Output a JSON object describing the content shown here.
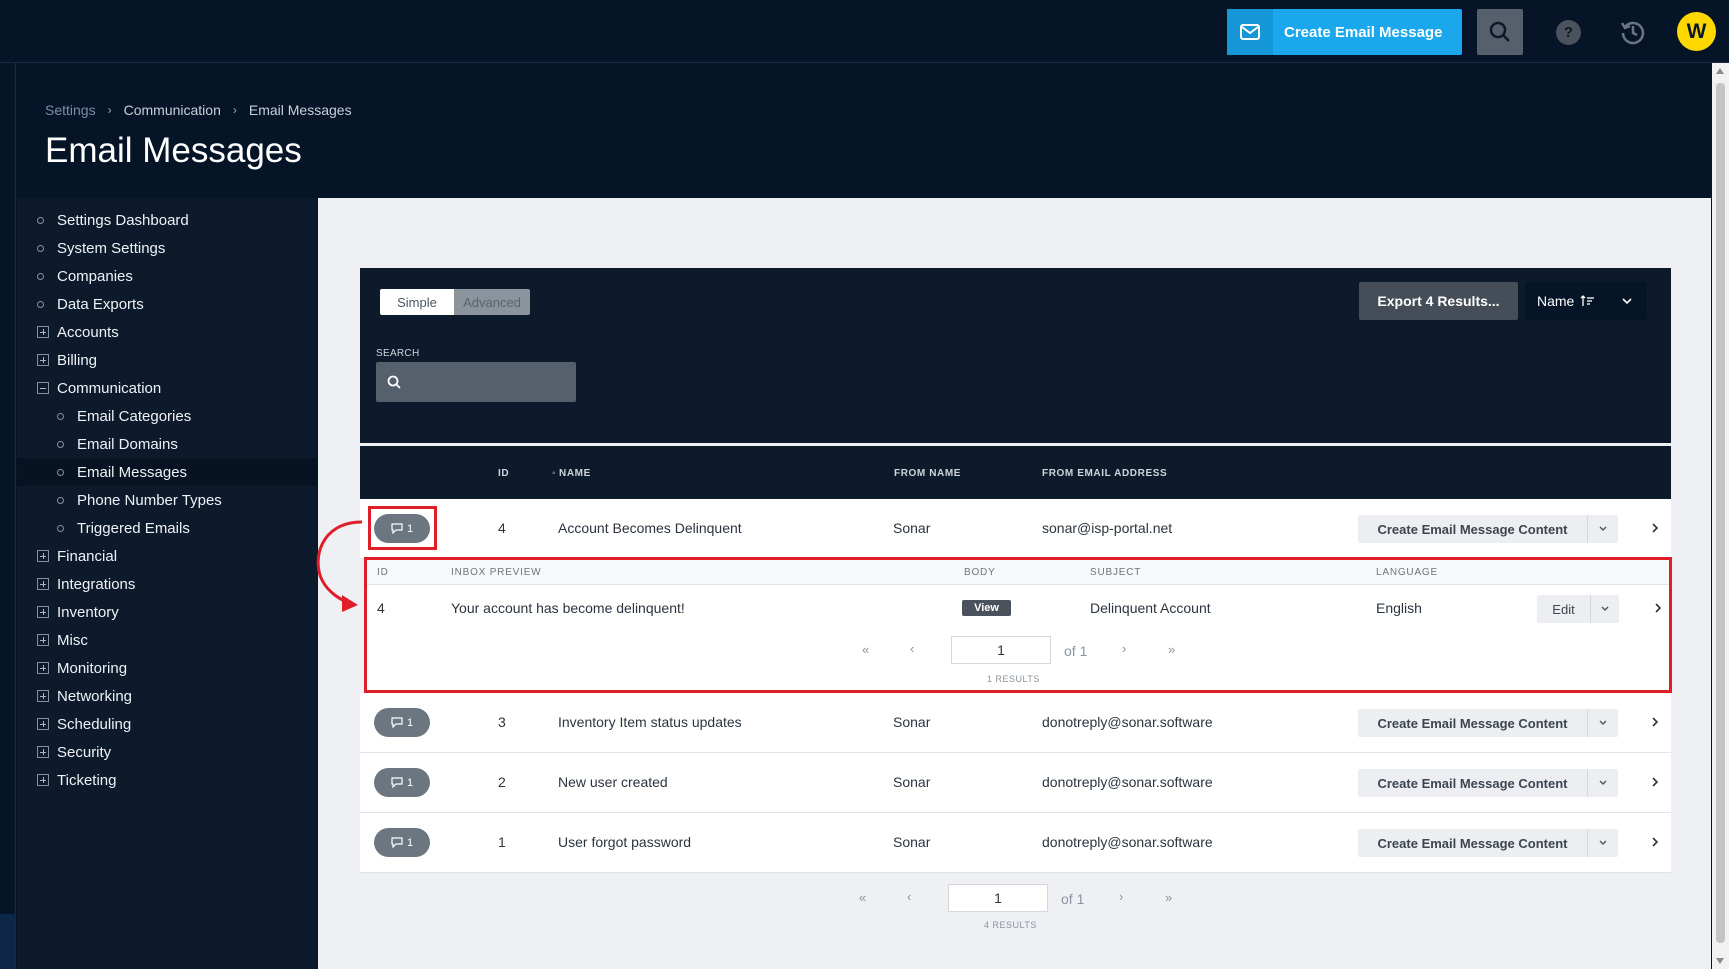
{
  "topbar": {
    "create_label": "Create Email Message",
    "avatar_initial": "W",
    "help_glyph": "?"
  },
  "breadcrumb": {
    "items": [
      "Settings",
      "Communication",
      "Email Messages"
    ]
  },
  "page": {
    "title": "Email Messages"
  },
  "sidebar": {
    "items": [
      {
        "label": "Settings Dashboard",
        "type": "leaf"
      },
      {
        "label": "System Settings",
        "type": "leaf"
      },
      {
        "label": "Companies",
        "type": "leaf"
      },
      {
        "label": "Data Exports",
        "type": "leaf"
      },
      {
        "label": "Accounts",
        "type": "collapsed"
      },
      {
        "label": "Billing",
        "type": "collapsed"
      },
      {
        "label": "Communication",
        "type": "expanded"
      },
      {
        "label": "Email Categories",
        "type": "child"
      },
      {
        "label": "Email Domains",
        "type": "child"
      },
      {
        "label": "Email Messages",
        "type": "child-active"
      },
      {
        "label": "Phone Number Types",
        "type": "child"
      },
      {
        "label": "Triggered Emails",
        "type": "child"
      },
      {
        "label": "Financial",
        "type": "collapsed"
      },
      {
        "label": "Integrations",
        "type": "collapsed"
      },
      {
        "label": "Inventory",
        "type": "collapsed"
      },
      {
        "label": "Misc",
        "type": "collapsed"
      },
      {
        "label": "Monitoring",
        "type": "collapsed"
      },
      {
        "label": "Networking",
        "type": "collapsed"
      },
      {
        "label": "Scheduling",
        "type": "collapsed"
      },
      {
        "label": "Security",
        "type": "collapsed"
      },
      {
        "label": "Ticketing",
        "type": "collapsed"
      }
    ]
  },
  "filters": {
    "simple_label": "Simple",
    "advanced_label": "Advanced",
    "search_label": "SEARCH",
    "search_value": "",
    "export_label": "Export 4 Results...",
    "sort_label": "Name"
  },
  "table": {
    "headers": {
      "id": "ID",
      "name": "NAME",
      "from_name": "FROM NAME",
      "from_email": "FROM EMAIL ADDRESS"
    },
    "content_button_label": "Create Email Message Content",
    "rows": [
      {
        "count": "1",
        "id": "4",
        "name": "Account Becomes Delinquent",
        "from_name": "Sonar",
        "from_email": "sonar@isp-portal.net"
      },
      {
        "count": "1",
        "id": "3",
        "name": "Inventory Item status updates",
        "from_name": "Sonar",
        "from_email": "donotreply@sonar.software"
      },
      {
        "count": "1",
        "id": "2",
        "name": "New user created",
        "from_name": "Sonar",
        "from_email": "donotreply@sonar.software"
      },
      {
        "count": "1",
        "id": "1",
        "name": "User forgot password",
        "from_name": "Sonar",
        "from_email": "donotreply@sonar.software"
      }
    ]
  },
  "expanded": {
    "headers": {
      "id": "ID",
      "preview": "INBOX PREVIEW",
      "body": "BODY",
      "subject": "SUBJECT",
      "language": "LANGUAGE"
    },
    "row": {
      "id": "4",
      "preview": "Your account has become delinquent!",
      "body_label": "View",
      "subject": "Delinquent Account",
      "language": "English",
      "edit_label": "Edit"
    },
    "pager": {
      "page": "1",
      "of": "of 1",
      "results": "1 RESULTS",
      "first": "«",
      "prev": "‹",
      "next": "›",
      "last": "»"
    }
  },
  "pager": {
    "page": "1",
    "of": "of 1",
    "results": "4 RESULTS",
    "first": "«",
    "prev": "‹",
    "next": "›",
    "last": "»"
  },
  "colors": {
    "accent": "#1aa7ec",
    "highlight": "#e01e2a",
    "avatar": "#ffd800",
    "nav_bg": "#061427"
  }
}
